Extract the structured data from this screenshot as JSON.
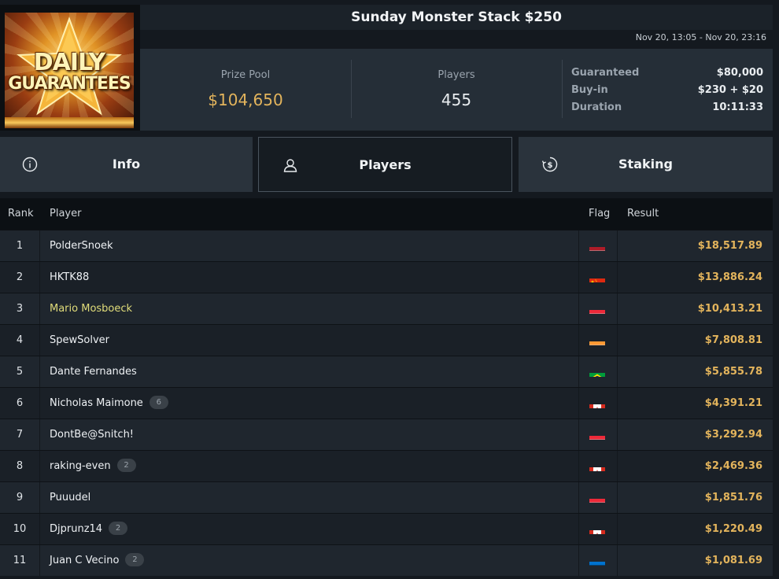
{
  "logo": {
    "line1": "DAILY",
    "line2": "GUARANTEES"
  },
  "header": {
    "title": "Sunday Monster Stack $250",
    "dates": "Nov 20, 13:05 - Nov 20, 23:16"
  },
  "stats": {
    "prize_pool_label": "Prize Pool",
    "prize_pool_value": "$104,650",
    "players_label": "Players",
    "players_value": "455",
    "details": [
      {
        "label": "Guaranteed",
        "value": "$80,000"
      },
      {
        "label": "Buy-in",
        "value": "$230 + $20"
      },
      {
        "label": "Duration",
        "value": "10:11:33"
      }
    ]
  },
  "tabs": [
    {
      "label": "Info",
      "icon": "info-icon"
    },
    {
      "label": "Players",
      "icon": "user-icon",
      "active": true
    },
    {
      "label": "Staking",
      "icon": "dollar-coin-icon"
    }
  ],
  "table": {
    "headers": {
      "rank": "Rank",
      "player": "Player",
      "flag": "Flag",
      "result": "Result"
    },
    "rows": [
      {
        "rank": "1",
        "player": "PolderSnoek",
        "flag": "NL",
        "result": "$18,517.89"
      },
      {
        "rank": "2",
        "player": "HKTK88",
        "flag": "CN",
        "result": "$13,886.24"
      },
      {
        "rank": "3",
        "player": "Mario Mosboeck",
        "flag": "AT",
        "result": "$10,413.21",
        "highlight": true
      },
      {
        "rank": "4",
        "player": "SpewSolver",
        "flag": "IN",
        "result": "$7,808.81"
      },
      {
        "rank": "5",
        "player": "Dante Fernandes",
        "flag": "BR",
        "result": "$5,855.78"
      },
      {
        "rank": "6",
        "player": "Nicholas Maimone",
        "badge": "6",
        "flag": "CA",
        "result": "$4,391.21"
      },
      {
        "rank": "7",
        "player": "DontBe@Snitch!",
        "flag": "AT",
        "result": "$3,292.94"
      },
      {
        "rank": "8",
        "player": "raking-even",
        "badge": "2",
        "flag": "CA",
        "result": "$2,469.36"
      },
      {
        "rank": "9",
        "player": "Puuudel",
        "flag": "AT",
        "result": "$1,851.76"
      },
      {
        "rank": "10",
        "player": "Djprunz14",
        "badge": "2",
        "flag": "CA",
        "result": "$1,220.49"
      },
      {
        "rank": "11",
        "player": "Juan C Vecino",
        "badge": "2",
        "flag": "EE",
        "result": "$1,081.69"
      }
    ]
  },
  "colors": {
    "accent_gold": "#e3b45c",
    "highlight_player": "#e0dc7a",
    "panel": "#252e37"
  }
}
